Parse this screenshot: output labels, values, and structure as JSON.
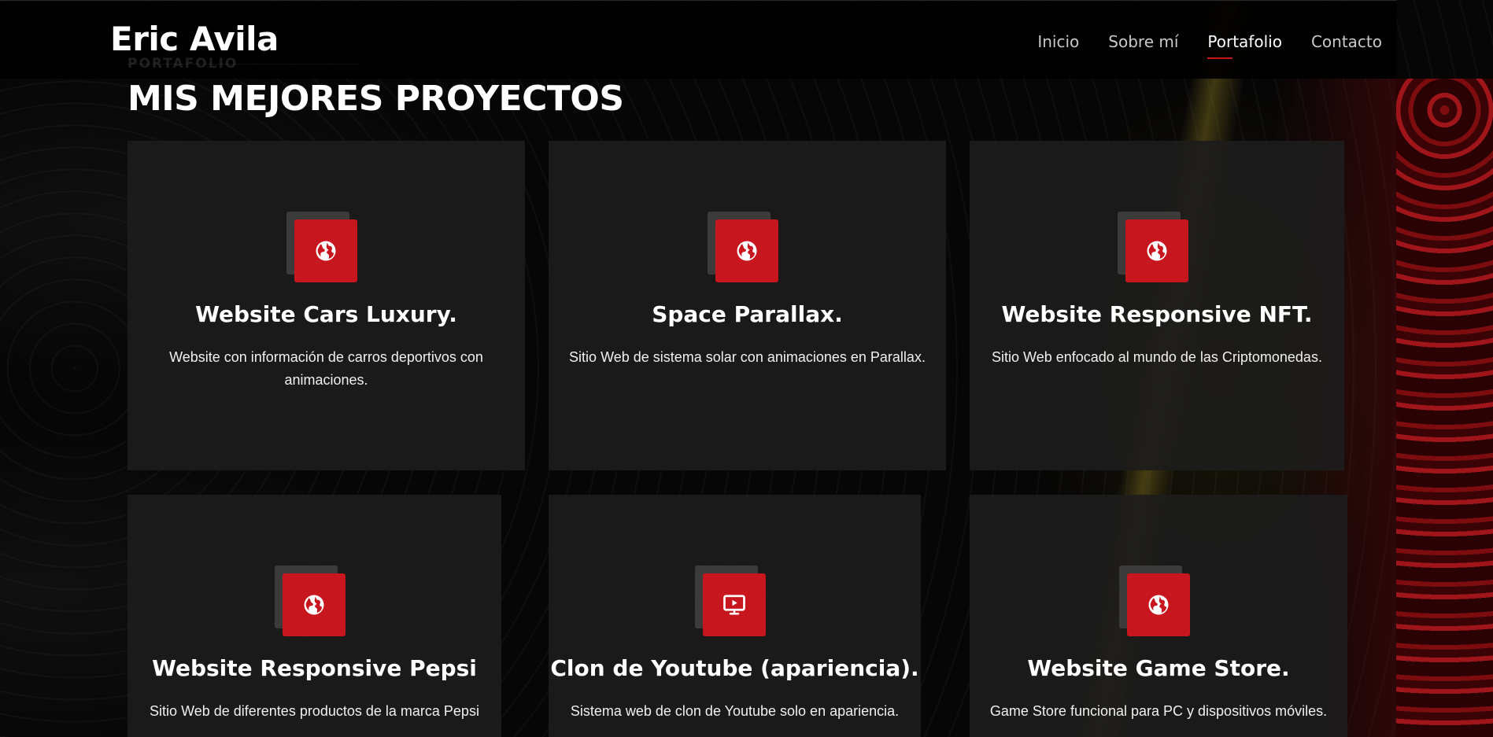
{
  "header": {
    "logo": "Eric Avila",
    "section_tag": "PORTAFOLIO",
    "nav": [
      {
        "label": "Inicio",
        "active": false
      },
      {
        "label": "Sobre mí",
        "active": false
      },
      {
        "label": "Portafolio",
        "active": true
      },
      {
        "label": "Contacto",
        "active": false
      }
    ]
  },
  "main": {
    "title": "MIS MEJORES PROYECTOS",
    "projects": [
      {
        "title": "Website Cars Luxury.",
        "description": "Website con información de carros deportivos con animaciones.",
        "icon": "globe-icon"
      },
      {
        "title": "Space Parallax.",
        "description": "Sitio Web de sistema solar con animaciones en Parallax.",
        "icon": "globe-icon"
      },
      {
        "title": "Website Responsive NFT.",
        "description": "Sitio Web enfocado al mundo de las Criptomonedas.",
        "icon": "globe-icon"
      },
      {
        "title": "Website Responsive Pepsi",
        "description": "Sitio Web de diferentes productos de la marca Pepsi",
        "icon": "globe-icon"
      },
      {
        "title": "Clon de Youtube (apariencia).",
        "description": "Sistema web de clon de Youtube solo en apariencia.",
        "icon": "monitor-play-icon"
      },
      {
        "title": "Website Game Store.",
        "description": "Game Store funcional para PC y dispositivos móviles.",
        "icon": "globe-icon"
      }
    ]
  },
  "colors": {
    "accent": "#c8161e",
    "card_bg": "#1c1c1c",
    "page_bg": "#050505"
  }
}
